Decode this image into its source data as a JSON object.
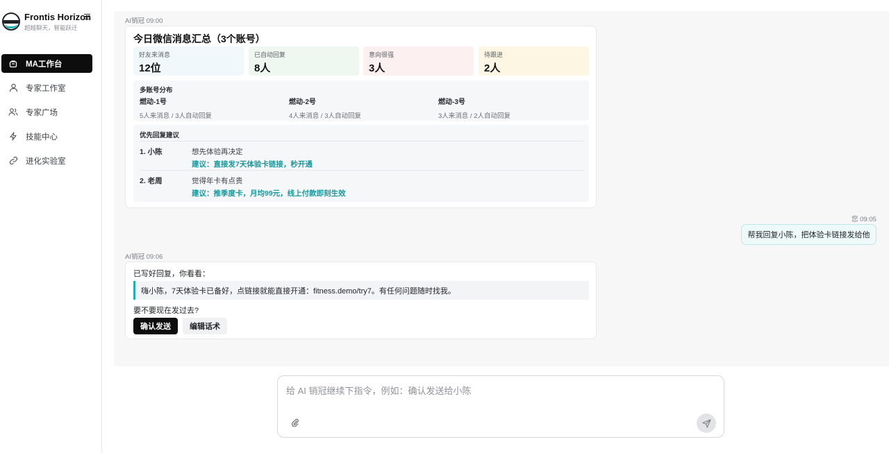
{
  "app": {
    "name": "Frontis Horizon",
    "tagline": "超越聊天，智能跃迁"
  },
  "sidebar": {
    "items": [
      {
        "label": "MA工作台",
        "icon": "briefcase-icon",
        "active": true
      },
      {
        "label": "专家工作室",
        "icon": "user-icon",
        "active": false
      },
      {
        "label": "专家广场",
        "icon": "users-icon",
        "active": false
      },
      {
        "label": "技能中心",
        "icon": "lightning-icon",
        "active": false
      },
      {
        "label": "进化实验室",
        "icon": "link-icon",
        "active": false
      }
    ]
  },
  "messages": {
    "summary": {
      "meta": "AI销冠 09:00",
      "title": "今日微信消息汇总（3个账号）",
      "stats": [
        {
          "label": "好友来消息",
          "value": "12位",
          "color": "#f1f8fb"
        },
        {
          "label": "已自动回复",
          "value": "8人",
          "color": "#eef8f1"
        },
        {
          "label": "意向很强",
          "value": "3人",
          "color": "#fdf0f0"
        },
        {
          "label": "待跟进",
          "value": "2人",
          "color": "#fdf6e3"
        }
      ],
      "distribution": {
        "title": "多账号分布",
        "accounts": [
          {
            "name": "燃动-1号",
            "detail": "5人来消息 / 3人自动回复"
          },
          {
            "name": "燃动-2号",
            "detail": "4人来消息 / 3人自动回复"
          },
          {
            "name": "燃动-3号",
            "detail": "3人来消息 / 2人自动回复"
          }
        ]
      },
      "suggestions": {
        "title": "优先回复建议",
        "items": [
          {
            "who": "1. 小陈",
            "what": "想先体验再决定",
            "advice": "建议：直接发7天体验卡链接，秒开通"
          },
          {
            "who": "2. 老周",
            "what": "觉得年卡有点贵",
            "advice": "建议：推季度卡，月均99元，线上付款即刻生效"
          }
        ]
      }
    },
    "user": {
      "meta": "您 09:05",
      "text": "帮我回复小陈，把体验卡链接发给他"
    },
    "reply": {
      "meta": "AI销冠 09:06",
      "intro": "已写好回复，你看看：",
      "quote": "嗨小陈，7天体验卡已备好，点链接就能直接开通：fitness.demo/try7。有任何问题随时找我。",
      "question": "要不要现在发过去?",
      "confirm_label": "确认发送",
      "edit_label": "编辑话术"
    }
  },
  "composer": {
    "placeholder": "给 AI 销冠继续下指令，例如：确认发送给小陈",
    "value": ""
  },
  "colors": {
    "accent": "#19b3b8",
    "advice": "#159aa0",
    "nav_active": "#0d0d0d"
  }
}
